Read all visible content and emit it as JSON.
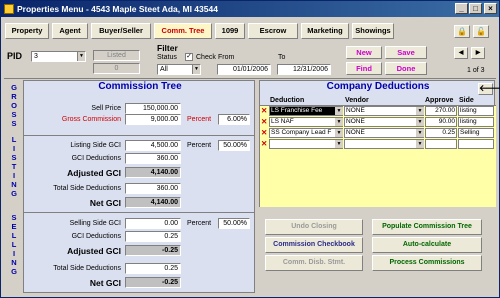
{
  "window": {
    "title": "Properties Menu - 4543 Maple Steet Ada, MI 43544",
    "minimize": "_",
    "maximize": "□",
    "close": "×"
  },
  "tabs": [
    {
      "label": "Property"
    },
    {
      "label": "Agent"
    },
    {
      "label": "Buyer/Seller"
    },
    {
      "label": "Comm. Tree",
      "active": true
    },
    {
      "label": "1099"
    },
    {
      "label": "Escrow"
    },
    {
      "label": "Marketing"
    },
    {
      "label": "Showings"
    }
  ],
  "toolbar_icons": [
    "lock-icon",
    "lock-open-icon"
  ],
  "pid": {
    "label": "PID",
    "value": "3",
    "listed_label": "Listed",
    "listed_value": "0"
  },
  "filter": {
    "title": "Filter",
    "status_label": "Status",
    "status_value": "All",
    "check_label": "Check",
    "checked": true,
    "from_label": "From",
    "from_value": "01/01/2006",
    "to_label": "To",
    "to_value": "12/31/2006"
  },
  "actions": {
    "new": "New",
    "save": "Save",
    "find": "Find",
    "done": "Done"
  },
  "record_nav": {
    "counter": "1 of 3"
  },
  "commission_tree": {
    "title": "Commission Tree",
    "side_labels": {
      "gross": "GROSS",
      "listing": "LISTING",
      "selling": "SELLING"
    },
    "gross": {
      "sell_price_label": "Sell Price",
      "sell_price": "150,000.00",
      "gross_comm_label": "Gross Commission",
      "gross_comm": "9,000.00",
      "percent_label": "Percent",
      "percent": "6.00%"
    },
    "listing": {
      "side_gci_label": "Listing Side GCI",
      "side_gci": "4,500.00",
      "percent_label": "Percent",
      "percent": "50.00%",
      "gci_ded_label": "GCI Deductions",
      "gci_ded": "360.00",
      "adj_gci_label": "Adjusted GCI",
      "adj_gci": "4,140.00",
      "total_ded_label": "Total Side Deductions",
      "total_ded": "360.00",
      "net_gci_label": "Net GCI",
      "net_gci": "4,140.00"
    },
    "selling": {
      "side_gci_label": "Selling Side GCI",
      "side_gci": "0.00",
      "percent_label": "Percent",
      "percent": "50.00%",
      "gci_ded_label": "GCI Deductions",
      "gci_ded": "0.25",
      "adj_gci_label": "Adjusted GCI",
      "adj_gci": "-0.25",
      "total_ded_label": "Total Side Deductions",
      "total_ded": "0.25",
      "net_gci_label": "Net GCI",
      "net_gci": "-0.25"
    }
  },
  "deductions": {
    "title": "Company Deductions",
    "back_icon": "arrow-left-icon",
    "columns": [
      "Deduction",
      "Vendor",
      "Approve",
      "Side"
    ],
    "rows": [
      {
        "deduction": "LS Franchise Fee",
        "vendor": "NONE",
        "approve": "270.00",
        "side": "listing"
      },
      {
        "deduction": "LS NAF",
        "vendor": "NONE",
        "approve": "90.00",
        "side": "listing"
      },
      {
        "deduction": "SS Company Lead F",
        "vendor": "NONE",
        "approve": "0.25",
        "side": "Selling"
      },
      {
        "deduction": "",
        "vendor": "",
        "approve": "",
        "side": ""
      }
    ]
  },
  "bottom_buttons": {
    "undo": "Undo Closing",
    "populate": "Populate Commission Tree",
    "checkbook": "Commission Checkbook",
    "autocalc": "Auto-calculate",
    "disb": "Comm. Disb. Stmt.",
    "process": "Process Commissions"
  }
}
